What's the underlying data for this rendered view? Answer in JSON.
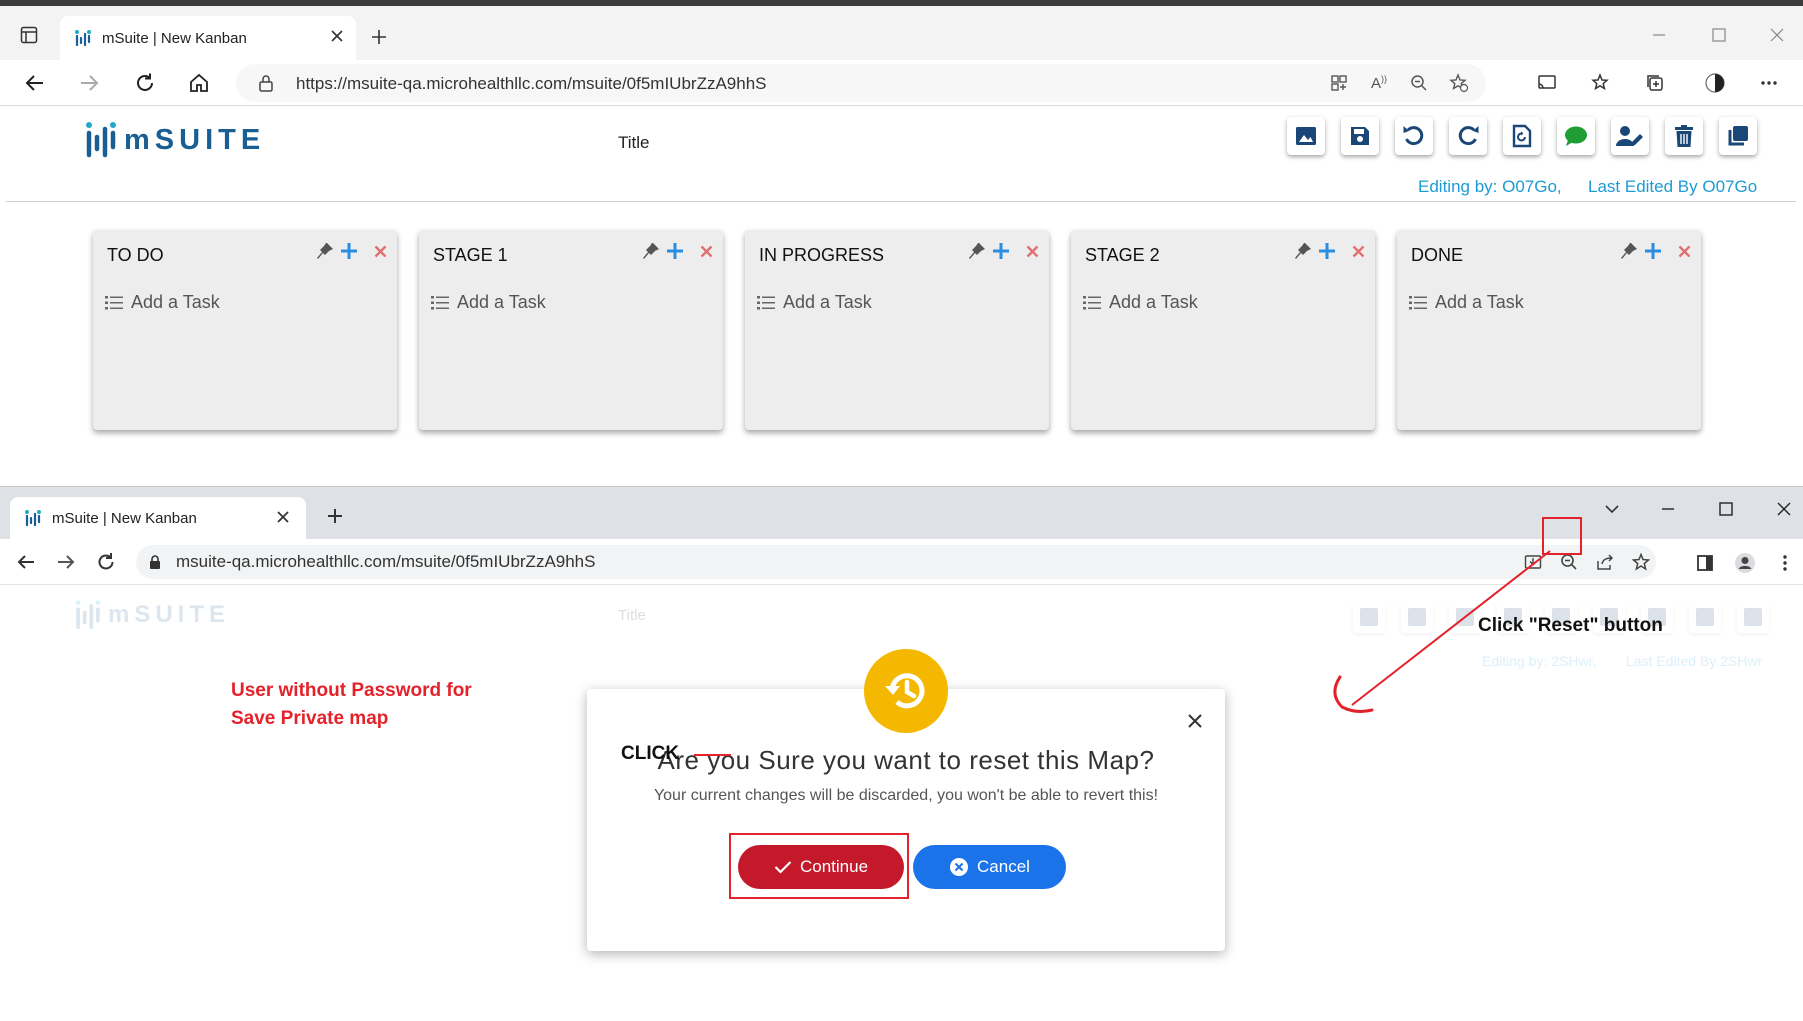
{
  "window1": {
    "tab_title": "mSuite | New Kanban",
    "url": "https://msuite-qa.microhealthllc.com/msuite/0f5mIUbrZzA9hhS"
  },
  "app1": {
    "logo_text": "mSUITE",
    "title": "Title",
    "editing_by": "Editing by: O07Go,",
    "last_edited": "Last Edited By O07Go",
    "toolbar_icons": [
      "image-icon",
      "save-icon",
      "undo-icon",
      "redo-icon",
      "reset-icon",
      "comment-icon",
      "user-edit-icon",
      "trash-icon",
      "copy-icon"
    ],
    "stages": [
      {
        "title": "TO DO",
        "add_label": "Add a Task"
      },
      {
        "title": "STAGE 1",
        "add_label": "Add a Task"
      },
      {
        "title": "IN PROGRESS",
        "add_label": "Add a Task"
      },
      {
        "title": "STAGE 2",
        "add_label": "Add a Task"
      },
      {
        "title": "DONE",
        "add_label": "Add a Task"
      }
    ]
  },
  "window2": {
    "tab_title": "mSuite | New Kanban",
    "url": "msuite-qa.microhealthllc.com/msuite/0f5mIUbrZzA9hhS"
  },
  "app2": {
    "logo_text": "mSUITE",
    "title": "Title",
    "editing_by": "Editing by: 2SHwr,",
    "last_edited": "Last Edited By 2SHwr"
  },
  "annotations": {
    "left_note_line1": "User without Password for",
    "left_note_line2": "Save Private map",
    "right_note": "Click \"Reset\" button",
    "click_label": "CLICK"
  },
  "dialog": {
    "title": "Are you Sure you want to reset this Map?",
    "message": "Your current changes will be discarded, you won't be able to revert this!",
    "continue_label": "Continue",
    "cancel_label": "Cancel"
  },
  "colors": {
    "brand_blue": "#1a5f93",
    "accent_cyan": "#1c9bd6",
    "warning_yellow": "#f5b800",
    "continue_red": "#c3192b",
    "cancel_blue": "#1a73e8",
    "annotation_red": "#e3222b"
  }
}
